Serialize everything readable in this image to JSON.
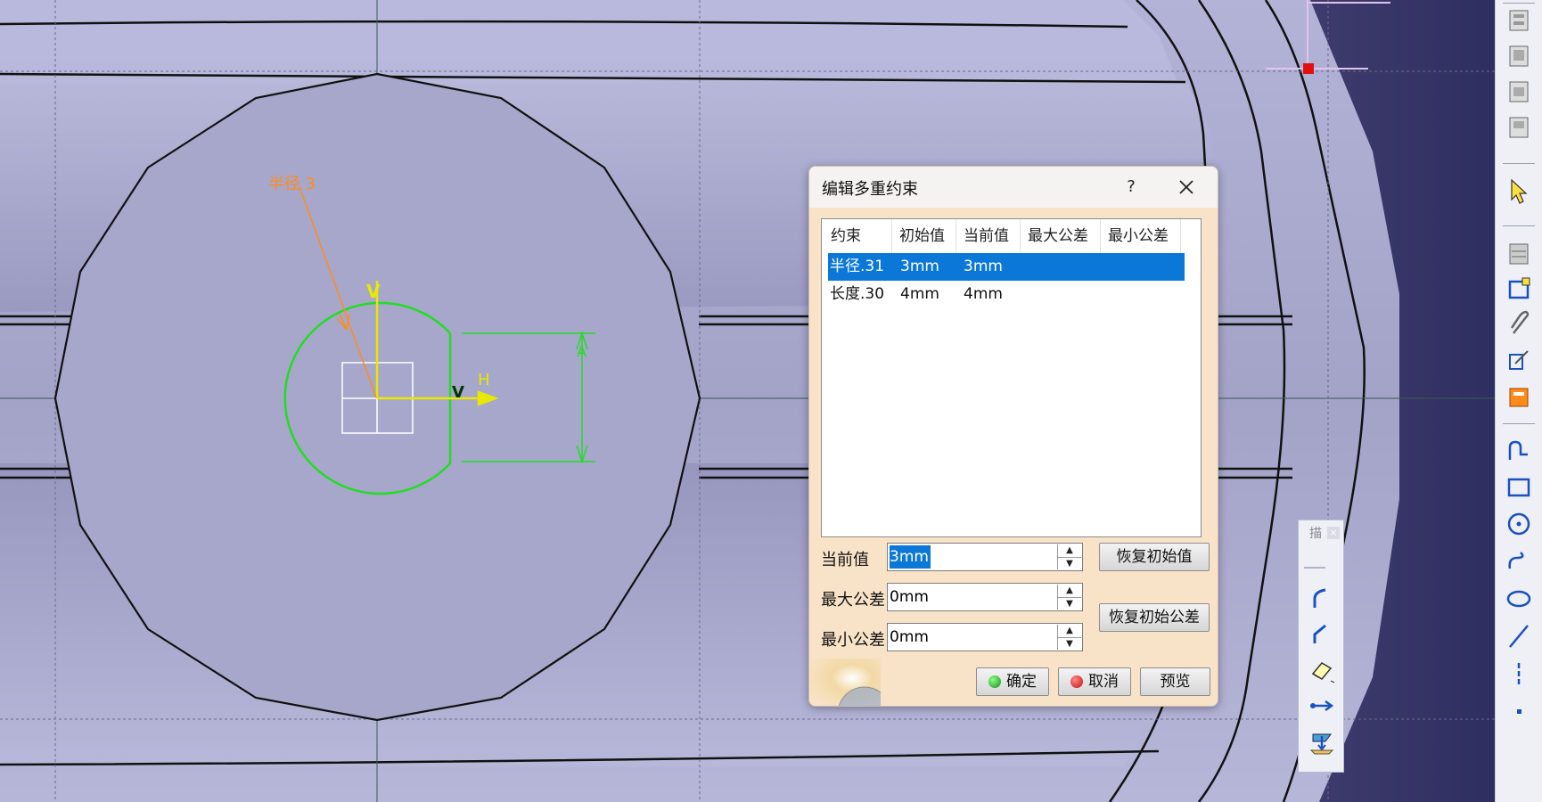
{
  "sketch": {
    "radius_label": "半径 3",
    "axis_v": "V",
    "axis_h": "H",
    "axis_v2": "V",
    "dimension_arrow_label": "A"
  },
  "dialog": {
    "title": "编辑多重约束",
    "help": "?",
    "table": {
      "headers": [
        "约束",
        "初始值",
        "当前值",
        "最大公差",
        "最小公差"
      ],
      "rows": [
        {
          "name": "半径.31",
          "initial": "3mm",
          "current": "3mm",
          "selected": true
        },
        {
          "name": "长度.30",
          "initial": "4mm",
          "current": "4mm",
          "selected": false
        }
      ]
    },
    "fields": {
      "current_label": "当前值",
      "current_value": "3mm",
      "max_tol_label": "最大公差",
      "max_tol_value": "0mm",
      "min_tol_label": "最小公差",
      "min_tol_value": "0mm"
    },
    "buttons": {
      "restore_initial": "恢复初始值",
      "restore_tolerance": "恢复初始公差",
      "ok": "确定",
      "cancel": "取消",
      "preview": "预览"
    }
  },
  "float_toolbar": {
    "title": "描",
    "close": "×"
  },
  "right_toolbar": {
    "icons": [
      "view-icon-1",
      "view-icon-2",
      "view-icon-3",
      "view-icon-4",
      "select-arrow-icon",
      "sketch-layout-icon",
      "frame-icon",
      "clip-icon",
      "transform-icon",
      "construction-icon",
      "profile-icon",
      "rectangle-icon",
      "circle-icon",
      "spline-icon",
      "ellipse-icon",
      "line-icon",
      "axis-icon",
      "point-icon"
    ]
  },
  "colors": {
    "viewport_bg": "#a9a9cf",
    "selection": "#0b78d8",
    "sketch_green": "#22dd22",
    "dialog_bg": "#f9e3c8",
    "dimension_orange": "#ff8c1a"
  }
}
